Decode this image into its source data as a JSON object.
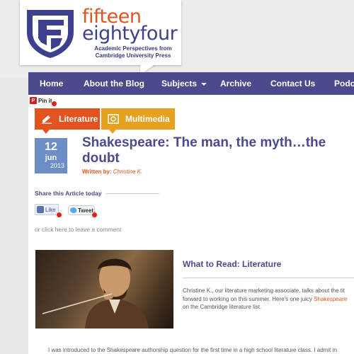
{
  "logo": {
    "title_part1": "fifteen",
    "title_part2": "eightyfour",
    "subtitle_line1": "Academic Perspectives from",
    "subtitle_line2": "Cambridge University Press"
  },
  "nav": {
    "items": [
      {
        "label": "Home"
      },
      {
        "label": "About the Blog"
      },
      {
        "label": "Subjects"
      },
      {
        "label": "Archive"
      },
      {
        "label": "Contact Us"
      },
      {
        "label": "Podc"
      }
    ]
  },
  "pinit": {
    "label": "Pin it"
  },
  "tags": [
    {
      "label": "Literature",
      "color": "#e2531f",
      "icon": "pencil-icon"
    },
    {
      "label": "Multimedia",
      "color": "#e8a020",
      "icon": "film-icon"
    }
  ],
  "date": {
    "day": "12",
    "month": "jun",
    "year": "2013"
  },
  "post": {
    "title": "Shakespeare: The man, the myth…the doubt",
    "written_by_label": "Written by:",
    "author": "Christine K."
  },
  "share": {
    "label": "Share this Article today",
    "like_label": "Like",
    "tweet_label": "Tweet",
    "comment_link": "or click here to leave a comment"
  },
  "section": {
    "heading": "What to Read: Literature",
    "line1": "Christine K., our literature marketing associate, talks about the tit",
    "line2_before": "forward to working on this summer. Here's one juicy ",
    "line2_highlight": "Shakespeare",
    "line3": "on the Cambridge literature list."
  },
  "body": {
    "paragraph": "I was introduced to the Shakespeare authorship question for the first time in a high school literature class. I admit m"
  },
  "colors": {
    "nav_bg": "#4c4a8c",
    "accent_orange": "#e2541f",
    "accent_yellow": "#e8a020",
    "date_blue": "#6b8ec7"
  }
}
